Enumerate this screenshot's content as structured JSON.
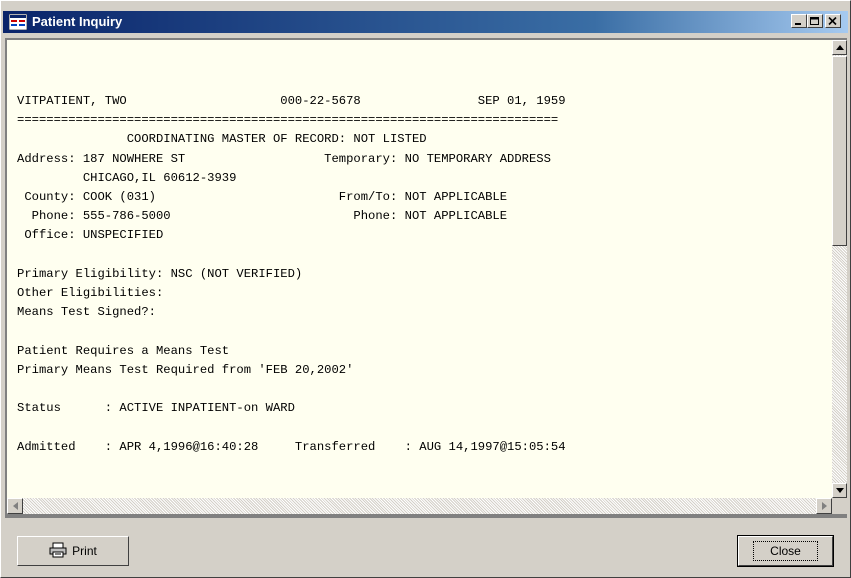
{
  "window": {
    "title": "Patient Inquiry"
  },
  "report": {
    "lines": [
      "VITPATIENT, TWO                     000-22-5678                SEP 01, 1959",
      "==========================================================================",
      "               COORDINATING MASTER OF RECORD: NOT LISTED",
      "Address: 187 NOWHERE ST                   Temporary: NO TEMPORARY ADDRESS",
      "         CHICAGO,IL 60612-3939",
      " County: COOK (031)                         From/To: NOT APPLICABLE",
      "  Phone: 555-786-5000                         Phone: NOT APPLICABLE",
      " Office: UNSPECIFIED",
      "",
      "Primary Eligibility: NSC (NOT VERIFIED)",
      "Other Eligibilities:",
      "Means Test Signed?:",
      "",
      "Patient Requires a Means Test",
      "Primary Means Test Required from 'FEB 20,2002'",
      "",
      "Status      : ACTIVE INPATIENT-on WARD",
      "",
      "Admitted    : APR 4,1996@16:40:28     Transferred    : AUG 14,1997@15:05:54"
    ]
  },
  "buttons": {
    "print": "Print",
    "close": "Close"
  },
  "icons": {
    "window_icon": "patient-inquiry-icon",
    "print_icon": "printer-icon",
    "minimize": "minimize-icon",
    "maximize": "maximize-icon",
    "close": "close-icon"
  },
  "colors": {
    "titlebar_start": "#0a246a",
    "pane_background": "#fffff0",
    "face": "#d4d0c8"
  }
}
